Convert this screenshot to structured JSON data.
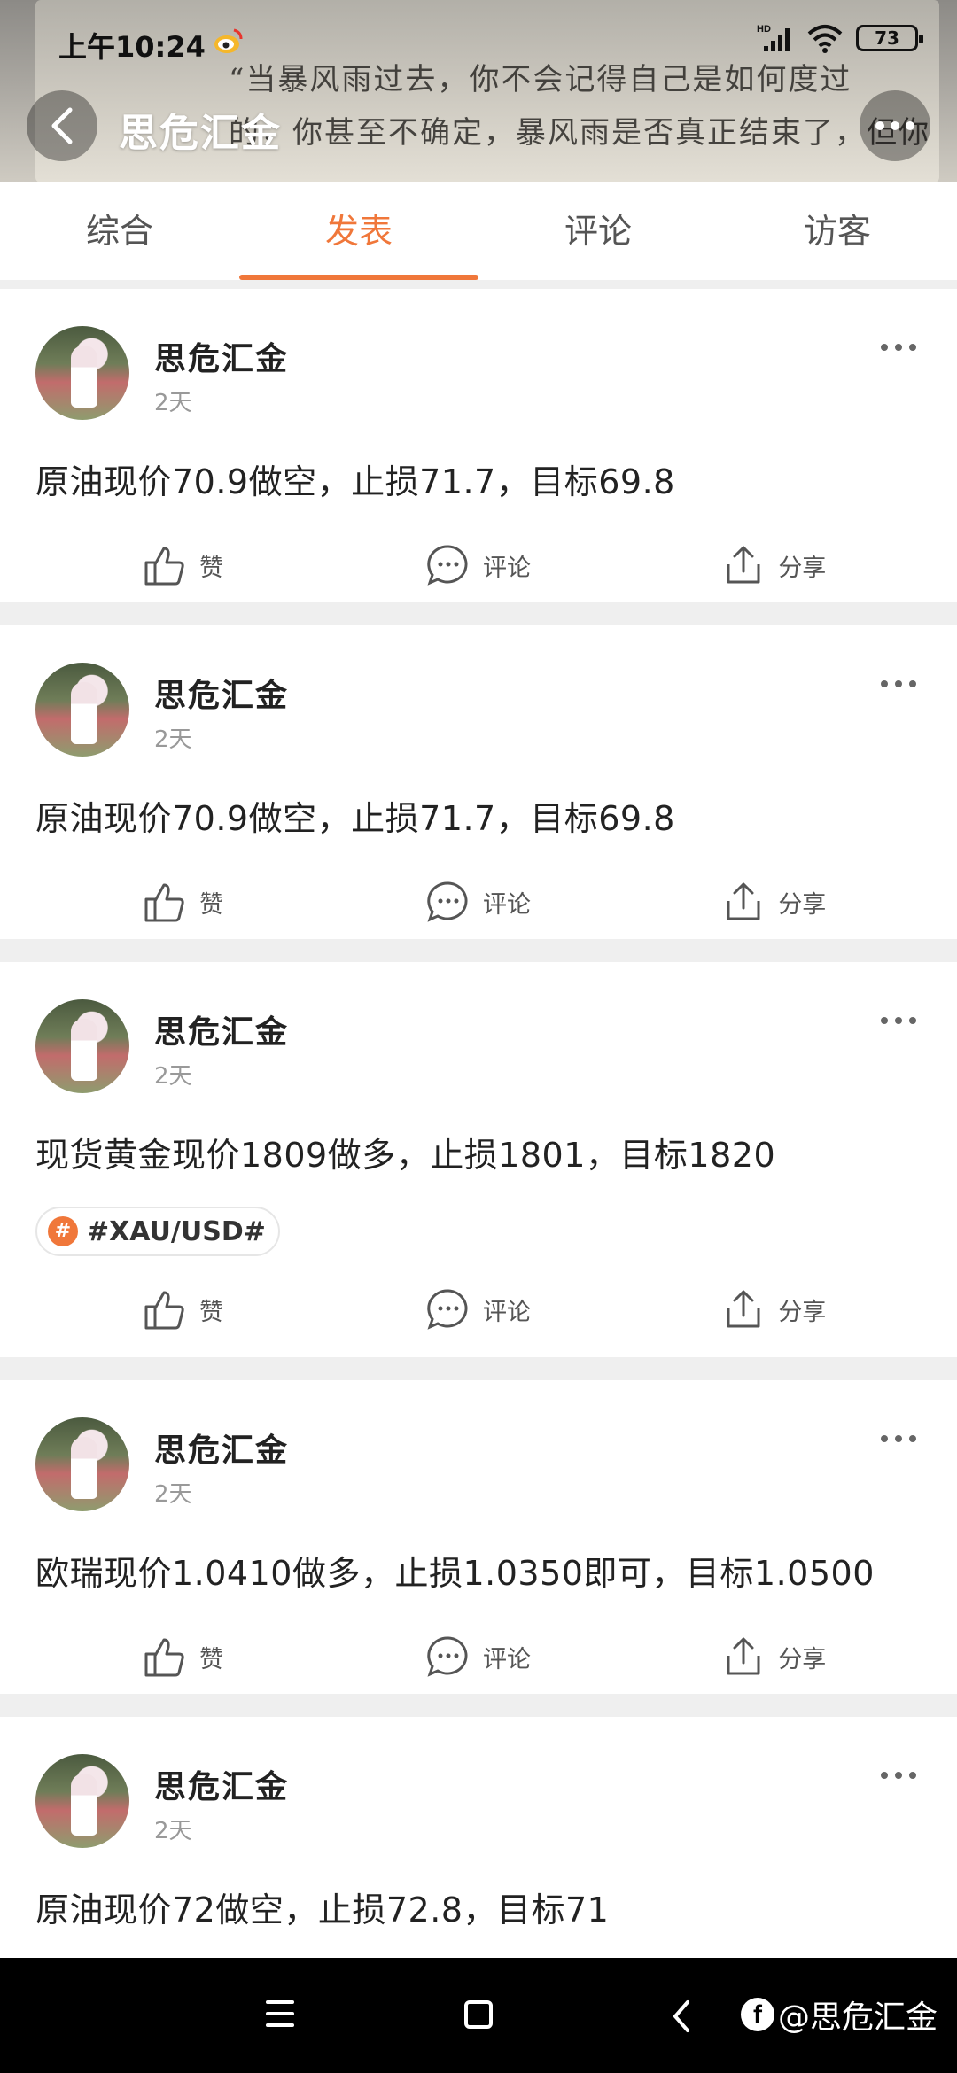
{
  "status": {
    "time": "上午10:24",
    "network": "HD",
    "battery": "73"
  },
  "header": {
    "title": "思危汇金",
    "quote_lines": [
      "“当暴风雨过去，你不会记得自己是如何度过",
      "的，你甚至不确定，暴风雨是否真正结束了，但你"
    ]
  },
  "tabs": [
    {
      "label": "综合",
      "active": false
    },
    {
      "label": "发表",
      "active": true
    },
    {
      "label": "评论",
      "active": false
    },
    {
      "label": "访客",
      "active": false
    }
  ],
  "posts": [
    {
      "author": "思危汇金",
      "time": "2天",
      "text": "原油现价70.9做空，止损71.7，目标69.8"
    },
    {
      "author": "思危汇金",
      "time": "2天",
      "text": "原油现价70.9做空，止损71.7，目标69.8"
    },
    {
      "author": "思危汇金",
      "time": "2天",
      "text": "现货黄金现价1809做多，止损1801，目标1820",
      "tag": "#XAU/USD#"
    },
    {
      "author": "思危汇金",
      "time": "2天",
      "text": "欧瑞现价1.0410做多，止损1.0350即可，目标1.0500"
    },
    {
      "author": "思危汇金",
      "time": "2天",
      "text": "原油现价72做空，止损72.8，目标71"
    }
  ],
  "actions": {
    "like": "赞",
    "comment": "评论",
    "share": "分享"
  },
  "watermark": "@思危汇金",
  "colors": {
    "accent": "#f0773a",
    "navbar": "#000000"
  }
}
